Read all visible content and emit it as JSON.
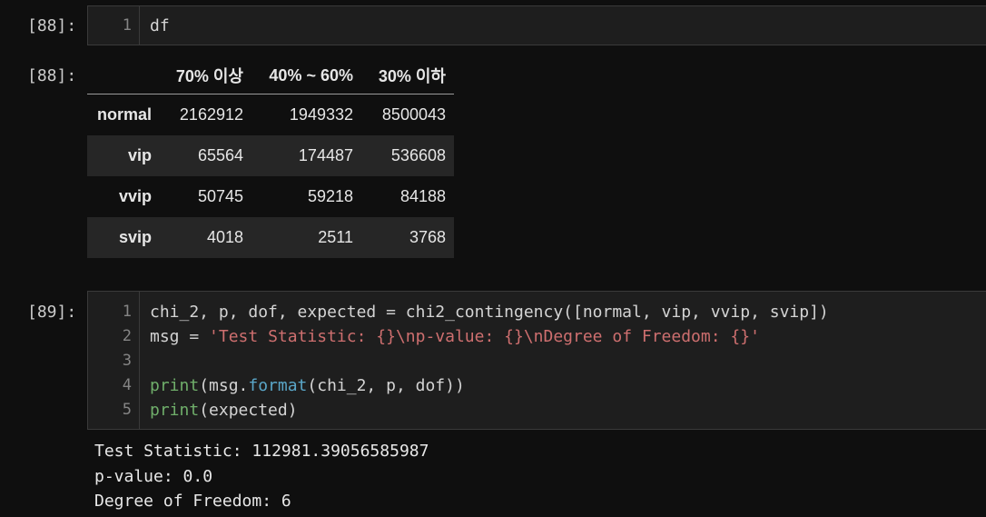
{
  "cells": [
    {
      "prompt_in": "[88]:",
      "code_lines": [
        {
          "num": "1",
          "text": "df"
        }
      ],
      "prompt_out": "[88]:",
      "table": {
        "columns": [
          "",
          "70% 이상",
          "40% ~ 60%",
          "30% 이하"
        ],
        "rows": [
          {
            "label": "normal",
            "values": [
              "2162912",
              "1949332",
              "8500043"
            ]
          },
          {
            "label": "vip",
            "values": [
              "65564",
              "174487",
              "536608"
            ]
          },
          {
            "label": "vvip",
            "values": [
              "50745",
              "59218",
              "84188"
            ]
          },
          {
            "label": "svip",
            "values": [
              "4018",
              "2511",
              "3768"
            ]
          }
        ]
      }
    },
    {
      "prompt_in": "[89]:",
      "code_lines": [
        {
          "num": "1",
          "parts": [
            {
              "t": "chi_2, p, dof, expected ",
              "c": ""
            },
            {
              "t": "=",
              "c": "op"
            },
            {
              "t": " chi2_contingency([normal, vip, vvip, svip])",
              "c": ""
            }
          ]
        },
        {
          "num": "2",
          "parts": [
            {
              "t": "msg ",
              "c": ""
            },
            {
              "t": "=",
              "c": "op"
            },
            {
              "t": " ",
              "c": ""
            },
            {
              "t": "'Test Statistic: {}\\np-value: {}\\nDegree of Freedom: {}'",
              "c": "str"
            }
          ]
        },
        {
          "num": "3",
          "parts": []
        },
        {
          "num": "4",
          "parts": [
            {
              "t": "print",
              "c": "fn"
            },
            {
              "t": "(msg.",
              "c": ""
            },
            {
              "t": "format",
              "c": "meth"
            },
            {
              "t": "(chi_2, p, dof))",
              "c": ""
            }
          ]
        },
        {
          "num": "5",
          "parts": [
            {
              "t": "print",
              "c": "fn"
            },
            {
              "t": "(expected)",
              "c": ""
            }
          ]
        }
      ],
      "output_lines": [
        "Test Statistic: 112981.39056585987",
        "p-value: 0.0",
        "Degree of Freedom: 6"
      ]
    }
  ],
  "colors": {
    "background": "#0f0f0f",
    "editor_bg": "#1e1e1e",
    "string": "#ce6f6f",
    "builtin_function": "#6fae6a",
    "method": "#5aa6c8"
  }
}
